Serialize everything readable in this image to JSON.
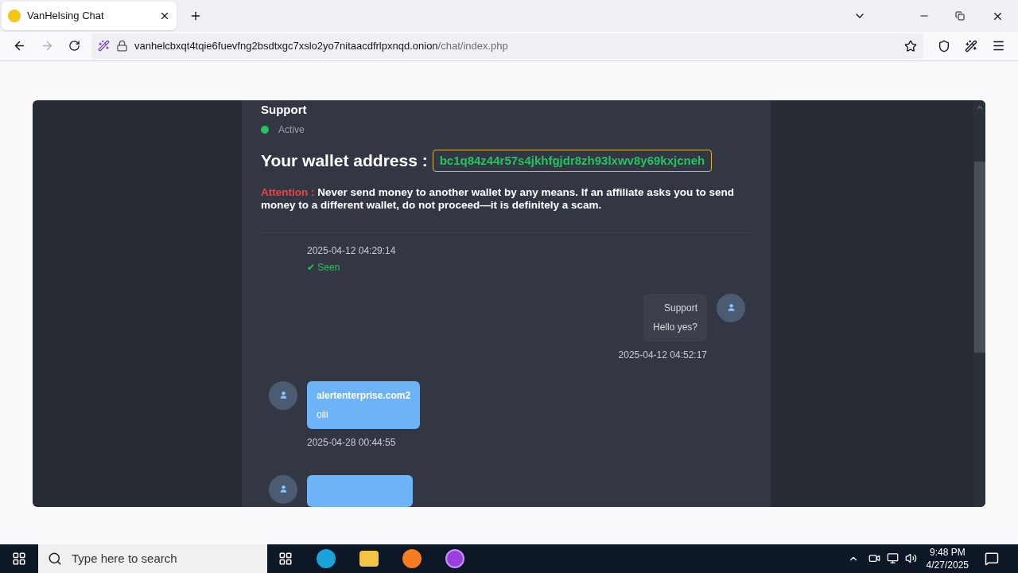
{
  "browser": {
    "tabs": [
      {
        "title": "VanHelsing Chat",
        "selected": true
      }
    ],
    "url": {
      "host": "vanhelcbxqt4tqie6fuevfng2bsdtxgc7xslo2yo7nitaacdfrlpxnqd.onion",
      "path": "/chat/index.php"
    }
  },
  "chat": {
    "contact": {
      "name": "Support",
      "status": "Active",
      "online": true
    },
    "wallet": {
      "label": "Your wallet address :",
      "address": "bc1q84z44r57s4jkhfgjdr8zh93lxwv8y69kxjcneh"
    },
    "notice": {
      "label": "Attention :",
      "text": "Never send money to another wallet by any means. If an affiliate asks you to send money to a different wallet, do not proceed—it is definitely a scam."
    },
    "messages": [
      {
        "kind": "partial",
        "time": "2025-04-12 04:29:14",
        "seen": "✔ Seen"
      },
      {
        "kind": "incoming",
        "sender": "Support",
        "text": "Hello yes?",
        "time": "2025-04-12 04:52:17"
      },
      {
        "kind": "outgoing",
        "sender": "alertenterprise.com2",
        "text": "oiii",
        "time": "2025-04-28 00:44:55"
      },
      {
        "kind": "cut"
      }
    ]
  },
  "taskbar": {
    "search": {
      "placeholder": "Type here to search"
    },
    "time": "9:48 PM",
    "date": "4/27/2025"
  }
}
